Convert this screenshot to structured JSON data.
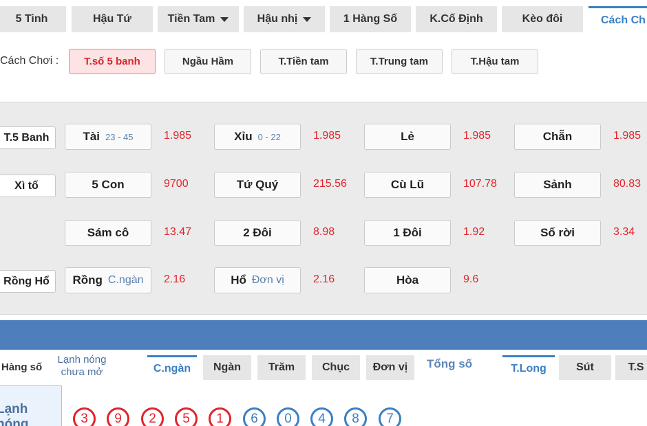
{
  "top_tabs": [
    {
      "label": "5 Tinh"
    },
    {
      "label": "Hậu Tứ"
    },
    {
      "label": "Tiền Tam"
    },
    {
      "label": "Hậu nhị"
    },
    {
      "label": "1 Hàng Số"
    },
    {
      "label": "K.Cố Định"
    },
    {
      "label": "Kèo đôi"
    },
    {
      "label": "Cách Ch"
    }
  ],
  "play_mode": {
    "label": "Cách Chơi :",
    "buttons": [
      {
        "label": "T.số 5 banh"
      },
      {
        "label": "Ngầu Hầm"
      },
      {
        "label": "T.Tiền tam"
      },
      {
        "label": "T.Trung tam"
      },
      {
        "label": "T.Hậu tam"
      }
    ]
  },
  "bets": {
    "row_labels": {
      "r1": "T.5 Banh",
      "r2": "Xì tố",
      "r4": "Rồng Hổ"
    },
    "row1": [
      {
        "label": "Tài",
        "sub": "23 - 45",
        "odds": "1.985"
      },
      {
        "label": "Xỉu",
        "sub": "0 - 22",
        "odds": "1.985"
      },
      {
        "label": "Lẻ",
        "odds": "1.985"
      },
      {
        "label": "Chẵn",
        "odds": "1.985"
      }
    ],
    "row2": [
      {
        "label": "5 Con",
        "odds": "9700"
      },
      {
        "label": "Tứ Quý",
        "odds": "215.56"
      },
      {
        "label": "Cù Lũ",
        "odds": "107.78"
      },
      {
        "label": "Sảnh",
        "odds": "80.83"
      }
    ],
    "row3": [
      {
        "label": "Sám cô",
        "odds": "13.47"
      },
      {
        "label": "2 Đôi",
        "odds": "8.98"
      },
      {
        "label": "1 Đôi",
        "odds": "1.92"
      },
      {
        "label": "Số rời",
        "odds": "3.34"
      }
    ],
    "row4": [
      {
        "label": "Rồng",
        "sub": "C.ngàn",
        "odds": "2.16"
      },
      {
        "label": "Hổ",
        "sub": "Đơn vị",
        "odds": "2.16"
      },
      {
        "label": "Hòa",
        "odds": "9.6"
      }
    ]
  },
  "bottom": {
    "hang_so": "Hàng số",
    "lanh_nong_line1": "Lạnh nóng",
    "lanh_nong_line2": "chưa mở",
    "digit_tabs": [
      {
        "label": "C.ngàn"
      },
      {
        "label": "Ngàn"
      },
      {
        "label": "Trăm"
      },
      {
        "label": "Chục"
      },
      {
        "label": "Đơn vị"
      }
    ],
    "tong_so": "Tổng số",
    "sum_tabs": [
      {
        "label": "T.Long"
      },
      {
        "label": "Sút"
      },
      {
        "label": "T.S"
      }
    ],
    "hot_label": "Lạnh nóng",
    "balls": [
      "3",
      "9",
      "2",
      "5",
      "1",
      "6",
      "0",
      "4",
      "8",
      "7"
    ]
  },
  "colors": {
    "accent_blue": "#3a7fc4",
    "odds_red": "#e0242b",
    "band_blue": "#4f7ebd",
    "active_mode_bg": "#fde3e3"
  }
}
